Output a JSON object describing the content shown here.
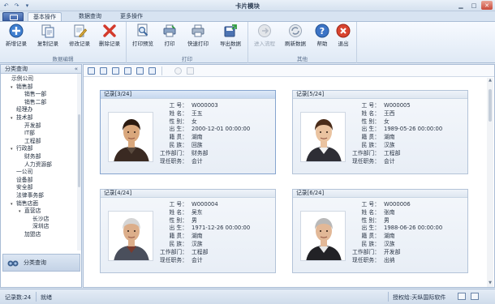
{
  "window": {
    "title": "卡片模块"
  },
  "tabs": [
    {
      "label": "基本操作",
      "active": true
    },
    {
      "label": "数据查询",
      "active": false
    },
    {
      "label": "更多操作",
      "active": false
    }
  ],
  "ribbon": {
    "groups": [
      {
        "label": "数据编辑",
        "buttons": [
          "新增记录",
          "复制记录",
          "修改记录",
          "删除记录"
        ]
      },
      {
        "label": "打印",
        "buttons": [
          "打印预览",
          "打印",
          "快速打印",
          "导出数据"
        ]
      },
      {
        "label": "其他",
        "buttons": [
          "进入流程",
          "刷新数据",
          "帮助",
          "退出"
        ]
      }
    ]
  },
  "left_panel": {
    "title": "分类查询",
    "collapse_glyph": "«",
    "footer_label": "分类查询",
    "tree": [
      {
        "label": "示例公司",
        "level": 0,
        "toggle": ""
      },
      {
        "label": "销售部",
        "level": 1,
        "toggle": "▾"
      },
      {
        "label": "销售一部",
        "level": 2,
        "toggle": ""
      },
      {
        "label": "销售二部",
        "level": 2,
        "toggle": ""
      },
      {
        "label": "经理办",
        "level": 1,
        "toggle": ""
      },
      {
        "label": "技术部",
        "level": 1,
        "toggle": "▾"
      },
      {
        "label": "开发部",
        "level": 2,
        "toggle": ""
      },
      {
        "label": "IT部",
        "level": 2,
        "toggle": ""
      },
      {
        "label": "工程部",
        "level": 2,
        "toggle": ""
      },
      {
        "label": "行政部",
        "level": 1,
        "toggle": "▾"
      },
      {
        "label": "财务部",
        "level": 2,
        "toggle": ""
      },
      {
        "label": "人力资源部",
        "level": 2,
        "toggle": ""
      },
      {
        "label": "一公司",
        "level": 1,
        "toggle": ""
      },
      {
        "label": "设备部",
        "level": 1,
        "toggle": ""
      },
      {
        "label": "安全部",
        "level": 1,
        "toggle": ""
      },
      {
        "label": "法律事务部",
        "level": 1,
        "toggle": ""
      },
      {
        "label": "销售店面",
        "level": 1,
        "toggle": "▾"
      },
      {
        "label": "直营店",
        "level": 2,
        "toggle": "▾"
      },
      {
        "label": "长沙店",
        "level": 3,
        "toggle": ""
      },
      {
        "label": "深圳店",
        "level": 3,
        "toggle": ""
      },
      {
        "label": "加盟店",
        "level": 2,
        "toggle": ""
      }
    ]
  },
  "field_labels": [
    "工 号：",
    "姓 名：",
    "性 别：",
    "出 生：",
    "籍 贯：",
    "民 族：",
    "工作部门：",
    "现任职务："
  ],
  "cards": [
    {
      "header": "记录[3/24]",
      "selected": true,
      "values": [
        "W000003",
        "王五",
        "女",
        "2000-12-01 00:00:00",
        "湖南",
        "回族",
        "财务部",
        "会计"
      ]
    },
    {
      "header": "记录[5/24]",
      "selected": false,
      "values": [
        "W000005",
        "王西",
        "女",
        "1989-05-26 00:00:00",
        "湖南",
        "汉族",
        "工程部",
        "会计"
      ]
    },
    {
      "header": "记录[4/24]",
      "selected": false,
      "values": [
        "W000004",
        "吴东",
        "男",
        "1971-12-26 00:00:00",
        "湖南",
        "汉族",
        "工程部",
        "会计"
      ]
    },
    {
      "header": "记录[6/24]",
      "selected": false,
      "values": [
        "W000006",
        "张南",
        "男",
        "1988-06-26 00:00:00",
        "湖南",
        "汉族",
        "开发部",
        "出纳"
      ]
    }
  ],
  "status": {
    "record_count": "记录数:24",
    "state": "就绪",
    "license": "授权给:天纵国际软件"
  }
}
